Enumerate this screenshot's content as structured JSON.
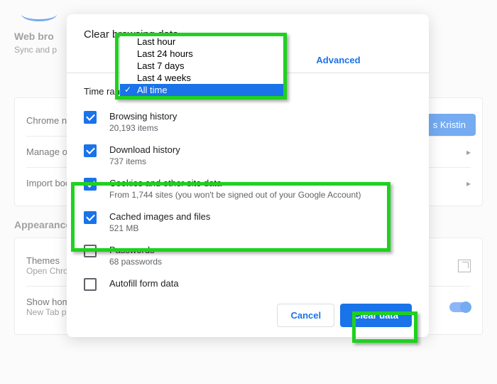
{
  "bg": {
    "web_browser_title": "Web bro",
    "web_browser_sub": "Sync and p",
    "chrome_name": "Chrome na",
    "manage": "Manage oth",
    "import": "Import boo",
    "appearance": "Appearance",
    "themes": "Themes",
    "open_chrome": "Open Chrom",
    "show_home": "Show home button",
    "new_tab": "New Tab page",
    "sync_btn": "s Kristin"
  },
  "modal": {
    "title": "Clear browsing data",
    "tab_advanced": "Advanced",
    "time_label": "Time range",
    "options": [
      "Last hour",
      "Last 24 hours",
      "Last 7 days",
      "Last 4 weeks",
      "All time"
    ],
    "selected_option": "All time",
    "items": [
      {
        "label": "Browsing history",
        "sub": "20,193 items",
        "checked": true
      },
      {
        "label": "Download history",
        "sub": "737 items",
        "checked": true
      },
      {
        "label": "Cookies and other site data",
        "sub": "From 1,744 sites (you won't be signed out of your Google Account)",
        "checked": true
      },
      {
        "label": "Cached images and files",
        "sub": "521 MB",
        "checked": true
      },
      {
        "label": "Passwords",
        "sub": "68 passwords",
        "checked": false
      },
      {
        "label": "Autofill form data",
        "sub": "",
        "checked": false
      }
    ],
    "cancel": "Cancel",
    "clear": "Clear data"
  }
}
